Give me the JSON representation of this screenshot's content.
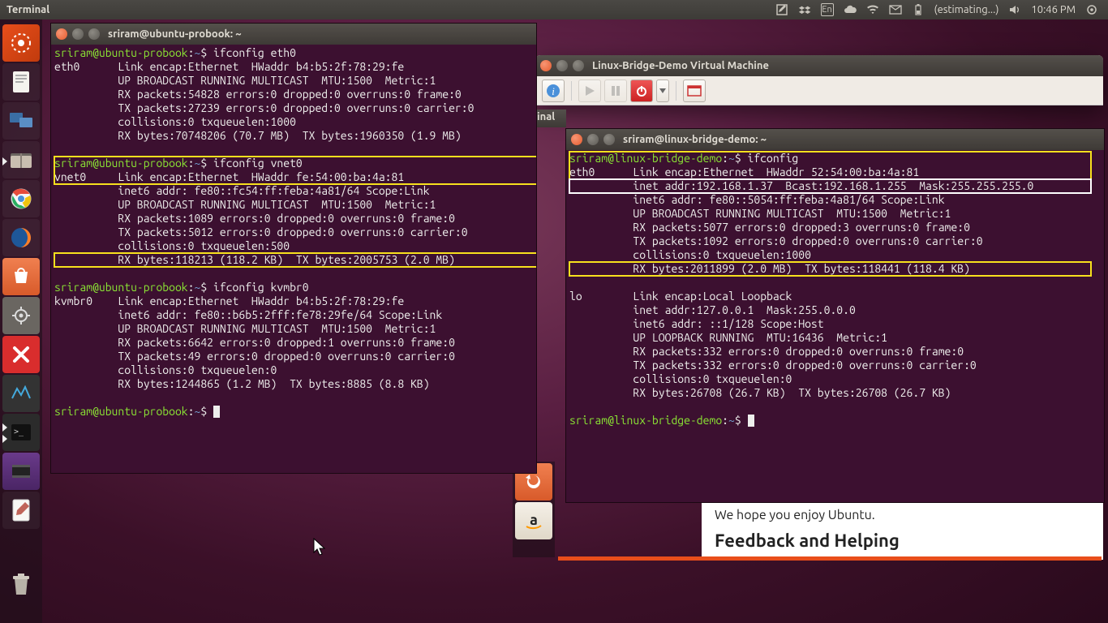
{
  "topbar": {
    "app": "Terminal",
    "battery": "(estimating...)",
    "time": "10:46 PM",
    "lang": "En"
  },
  "launcher": {
    "items": [
      {
        "name": "dash",
        "color": "#e84e1b"
      },
      {
        "name": "files",
        "color": "#e6e0d8"
      },
      {
        "name": "firefox",
        "color": "#0a84ff"
      },
      {
        "name": "nautilus",
        "color": "#b08050"
      },
      {
        "name": "thunderbird",
        "color": "#2e88d6"
      },
      {
        "name": "chrome",
        "color": "#f5f5f5"
      },
      {
        "name": "ff2",
        "color": "#ff7f27"
      },
      {
        "name": "software",
        "color": "#ef6c35"
      },
      {
        "name": "settings",
        "color": "#777"
      },
      {
        "name": "remote",
        "color": "#d92d2d"
      },
      {
        "name": "media",
        "color": "#444"
      },
      {
        "name": "terminal",
        "color": "#222",
        "active": true
      },
      {
        "name": "cheese",
        "color": "#a050c0"
      },
      {
        "name": "text",
        "color": "#eee"
      },
      {
        "name": "trash",
        "color": "#aaa"
      }
    ]
  },
  "vm_window": {
    "title": "Linux-Bridge-Demo Virtual Machine"
  },
  "term1": {
    "title": "sriram@ubuntu-probook: ~",
    "prompt_user": "sriram@ubuntu-probook",
    "prompt_path": "~",
    "cmd1": "ifconfig eth0",
    "out1": "eth0      Link encap:Ethernet  HWaddr b4:b5:2f:78:29:fe  \n          UP BROADCAST RUNNING MULTICAST  MTU:1500  Metric:1\n          RX packets:54828 errors:0 dropped:0 overruns:0 frame:0\n          TX packets:27239 errors:0 dropped:0 overruns:0 carrier:0\n          collisions:0 txqueuelen:1000 \n          RX bytes:70748206 (70.7 MB)  TX bytes:1960350 (1.9 MB)\n",
    "cmd2": "ifconfig vnet0",
    "out2a": "vnet0     Link encap:Ethernet  HWaddr fe:54:00:ba:4a:81  ",
    "out2b": "          inet6 addr: fe80::fc54:ff:feba:4a81/64 Scope:Link\n          UP BROADCAST RUNNING MULTICAST  MTU:1500  Metric:1\n          RX packets:1089 errors:0 dropped:0 overruns:0 frame:0\n          TX packets:5012 errors:0 dropped:0 overruns:0 carrier:0\n          collisions:0 txqueuelen:500 ",
    "out2c": "          RX bytes:118213 (118.2 KB)  TX bytes:2005753 (2.0 MB)  ",
    "cmd3": "ifconfig kvmbr0",
    "out3": "kvmbr0    Link encap:Ethernet  HWaddr b4:b5:2f:78:29:fe  \n          inet6 addr: fe80::b6b5:2fff:fe78:29fe/64 Scope:Link\n          UP BROADCAST RUNNING MULTICAST  MTU:1500  Metric:1\n          RX packets:6642 errors:0 dropped:1 overruns:0 frame:0\n          TX packets:49 errors:0 dropped:0 overruns:0 carrier:0\n          collisions:0 txqueuelen:0 \n          RX bytes:1244865 (1.2 MB)  TX bytes:8885 (8.8 KB)\n"
  },
  "term2": {
    "title": "sriram@linux-bridge-demo: ~",
    "prompt_user": "sriram@linux-bridge-demo",
    "prompt_path": "~",
    "cmd1": "ifconfig",
    "out1a": "eth0      Link encap:Ethernet  HWaddr 52:54:00:ba:4a:81  ",
    "out1b": "          inet addr:192.168.1.37  Bcast:192.168.1.255  Mask:255.255.255.0",
    "out1c": "          inet6 addr: fe80::5054:ff:feba:4a81/64 Scope:Link\n          UP BROADCAST RUNNING MULTICAST  MTU:1500  Metric:1\n          RX packets:5077 errors:0 dropped:3 overruns:0 frame:0\n          TX packets:1092 errors:0 dropped:0 overruns:0 carrier:0\n          collisions:0 txqueuelen:1000 ",
    "out1d": "          RX bytes:2011899 (2.0 MB)  TX bytes:118441 (118.4 KB)",
    "out2": "\nlo        Link encap:Local Loopback  \n          inet addr:127.0.0.1  Mask:255.0.0.0\n          inet6 addr: ::1/128 Scope:Host\n          UP LOOPBACK RUNNING  MTU:16436  Metric:1\n          RX packets:332 errors:0 dropped:0 overruns:0 frame:0\n          TX packets:332 errors:0 dropped:0 overruns:0 carrier:0\n          collisions:0 txqueuelen:0 \n          RX bytes:26708 (26.7 KB)  TX bytes:26708 (26.7 KB)\n"
  },
  "vm_inner_titlebar": "inal",
  "browser": {
    "line1": "We hope you enjoy Ubuntu.",
    "heading": "Feedback and Helping"
  }
}
